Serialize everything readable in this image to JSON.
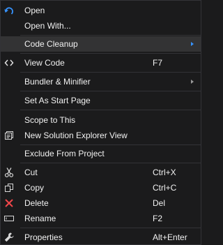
{
  "menu": {
    "items": [
      {
        "label": "Open",
        "icon": "refresh-arrow-icon"
      },
      {
        "label": "Open With..."
      },
      {
        "label": "Code Cleanup",
        "submenu": true,
        "highlighted": true
      },
      {
        "label": "View Code",
        "shortcut": "F7",
        "icon": "code-brackets-icon"
      },
      {
        "label": "Bundler & Minifier",
        "submenu": true
      },
      {
        "label": "Set As Start Page"
      },
      {
        "label": "Scope to This"
      },
      {
        "label": "New Solution Explorer View",
        "icon": "new-window-icon"
      },
      {
        "label": "Exclude From Project"
      },
      {
        "label": "Cut",
        "shortcut": "Ctrl+X",
        "icon": "scissors-icon"
      },
      {
        "label": "Copy",
        "shortcut": "Ctrl+C",
        "icon": "copy-icon"
      },
      {
        "label": "Delete",
        "shortcut": "Del",
        "icon": "delete-x-icon"
      },
      {
        "label": "Rename",
        "shortcut": "F2",
        "icon": "rename-icon"
      },
      {
        "label": "Properties",
        "shortcut": "Alt+Enter",
        "icon": "wrench-icon"
      }
    ]
  },
  "colors": {
    "background": "#1b1b1c",
    "highlight": "#333334",
    "separator": "#333337",
    "text": "#f1f1f1",
    "accent_blue": "#3794ff",
    "delete_red": "#f1464a",
    "submenu_arrow_active": "#3794ff",
    "submenu_arrow": "#999999"
  }
}
